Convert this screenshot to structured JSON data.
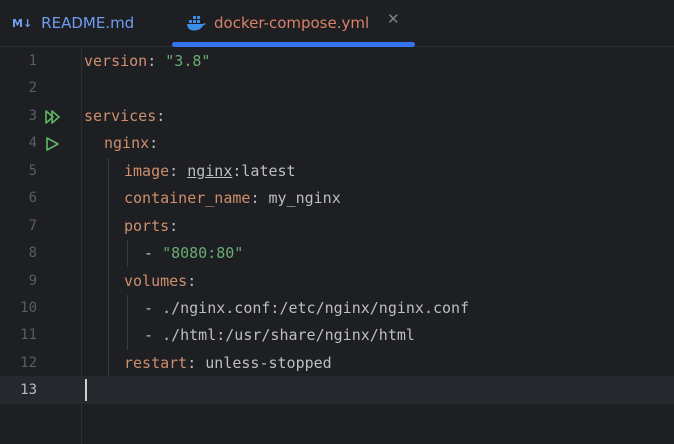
{
  "tabs": [
    {
      "badge": "M↓",
      "label": "README.md",
      "icon": "markdown-icon"
    },
    {
      "label": "docker-compose.yml",
      "icon": "docker-icon",
      "active": true,
      "close": "✕"
    }
  ],
  "colors": {
    "background": "#1e1f22",
    "keyword": "#cf8e6d",
    "string": "#6aab73",
    "text": "#bcbec4",
    "accent": "#3574f0",
    "line_number": "#5a5d63",
    "run_icon": "#5fb865"
  },
  "editor": {
    "active_line": "13",
    "line_numbers": [
      "1",
      "2",
      "3",
      "4",
      "5",
      "6",
      "7",
      "8",
      "9",
      "10",
      "11",
      "12",
      "13"
    ],
    "lines": {
      "l1": {
        "key": "version",
        "colon": ": ",
        "value": "\"3.8\""
      },
      "l3": {
        "key": "services",
        "colon": ":"
      },
      "l4": {
        "key": "nginx",
        "colon": ":"
      },
      "l5": {
        "key": "image",
        "colon": ": ",
        "value_link": "nginx",
        "value_rest": ":latest"
      },
      "l6": {
        "key": "container_name",
        "colon": ": ",
        "value": "my_nginx"
      },
      "l7": {
        "key": "ports",
        "colon": ":"
      },
      "l8": {
        "dash": "- ",
        "value": "\"8080:80\""
      },
      "l9": {
        "key": "volumes",
        "colon": ":"
      },
      "l10": {
        "dash": "- ",
        "value": "./nginx.conf:/etc/nginx/nginx.conf"
      },
      "l11": {
        "dash": "- ",
        "value": "./html:/usr/share/nginx/html"
      },
      "l12": {
        "key": "restart",
        "colon": ": ",
        "value": "unless-stopped"
      }
    },
    "gutter_icons": [
      "run-all-icon",
      "run-icon"
    ]
  }
}
